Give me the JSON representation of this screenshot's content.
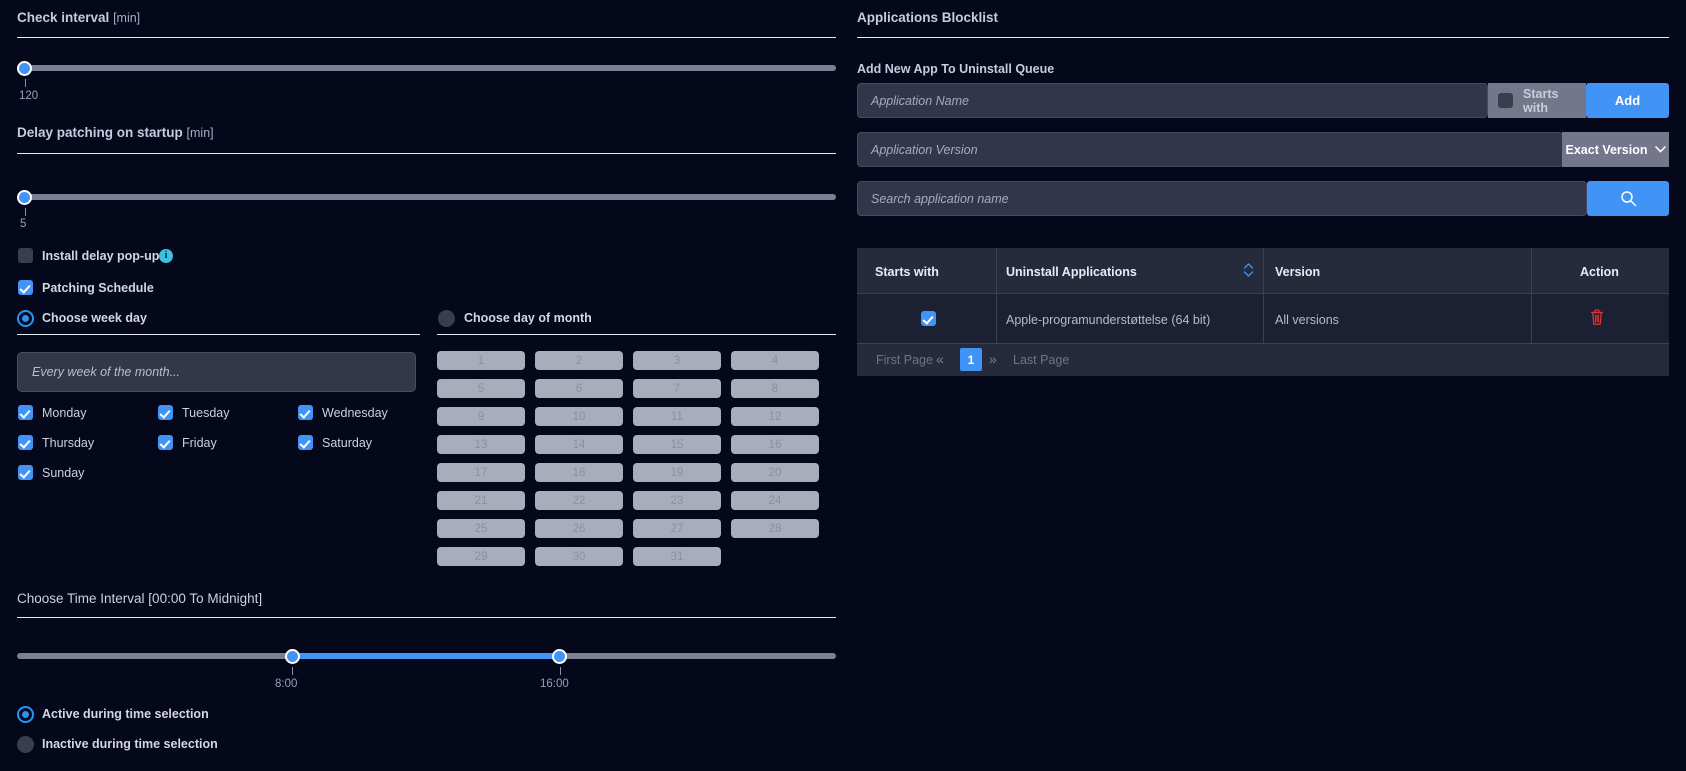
{
  "left": {
    "check_interval": {
      "title": "Check interval",
      "unit": "[min]",
      "value": "120"
    },
    "delay_patching": {
      "title": "Delay patching on startup",
      "unit": "[min]",
      "value": "5"
    },
    "install_delay_popup": {
      "label": "Install delay pop-up",
      "info": "i",
      "checked": false
    },
    "patching_schedule": {
      "label": "Patching Schedule",
      "checked": true
    },
    "choose_week_day": {
      "label": "Choose week day",
      "selected": true
    },
    "choose_day_of_month": {
      "label": "Choose day of month",
      "selected": false
    },
    "week_select": {
      "placeholder": "Every week of the month..."
    },
    "weekdays": [
      {
        "label": "Monday",
        "checked": true
      },
      {
        "label": "Tuesday",
        "checked": true
      },
      {
        "label": "Wednesday",
        "checked": true
      },
      {
        "label": "Thursday",
        "checked": true
      },
      {
        "label": "Friday",
        "checked": true
      },
      {
        "label": "Saturday",
        "checked": true
      },
      {
        "label": "Sunday",
        "checked": true
      }
    ],
    "days_of_month": [
      "1",
      "2",
      "3",
      "4",
      "5",
      "6",
      "7",
      "8",
      "9",
      "10",
      "11",
      "12",
      "13",
      "14",
      "15",
      "16",
      "17",
      "18",
      "19",
      "20",
      "21",
      "22",
      "23",
      "24",
      "25",
      "26",
      "27",
      "28",
      "29",
      "30",
      "31"
    ],
    "time_interval": {
      "title": "Choose Time Interval [00:00 To Midnight]",
      "start": "8:00",
      "end": "16:00"
    },
    "active_option": {
      "label": "Active during time selection",
      "selected": true
    },
    "inactive_option": {
      "label": "Inactive during time selection",
      "selected": false
    }
  },
  "right": {
    "title": "Applications Blocklist",
    "add_label": "Add New App To Uninstall Queue",
    "app_name": {
      "placeholder": "Application Name",
      "value": ""
    },
    "starts_with": {
      "label": "Starts with",
      "checked": false
    },
    "add_button": "Add",
    "app_version": {
      "placeholder": "Application Version",
      "value": ""
    },
    "version_mode": {
      "label": "Exact Version",
      "caret": "chevron-down"
    },
    "search": {
      "placeholder": "Search application name",
      "value": ""
    },
    "table": {
      "columns": [
        "Starts with",
        "Uninstall Applications",
        "Version",
        "Action"
      ],
      "rows": [
        {
          "starts_with": true,
          "application": "Apple-programunderstøttelse (64 bit)",
          "version": "All versions",
          "action": "delete"
        }
      ]
    },
    "pagination": {
      "first": "First Page",
      "prev": "«",
      "current": "1",
      "next": "»",
      "last": "Last Page"
    }
  },
  "colors": {
    "background": "#05071a",
    "accent": "#4193f5",
    "danger": "#d93636",
    "info": "#3ec0e0",
    "panel": "#1b2133"
  }
}
